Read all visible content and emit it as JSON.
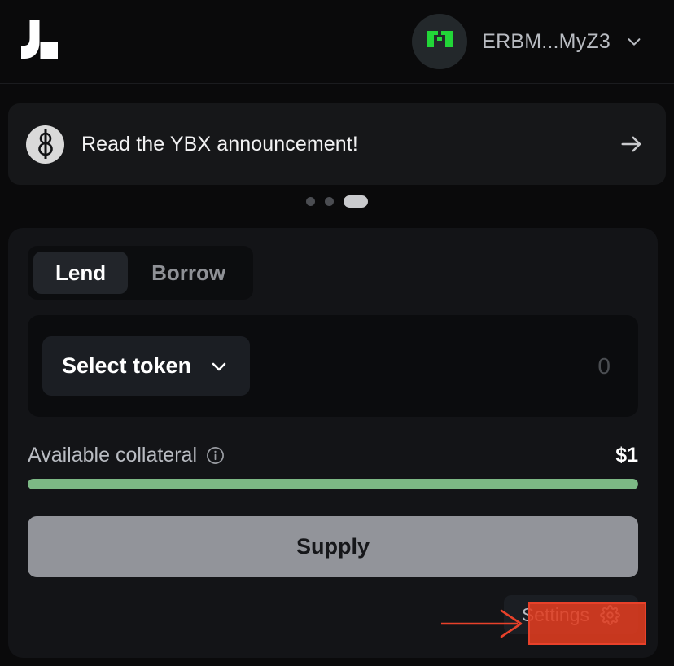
{
  "header": {
    "logo_name": "marginfi-logo",
    "wallet": {
      "address": "ERBM...MyZ3",
      "avatar_icon": "identicon-avatar",
      "chevron_icon": "chevron-down-icon"
    }
  },
  "banner": {
    "icon": "ybx-token-icon",
    "text": "Read the YBX announcement!",
    "arrow_icon": "arrow-right-icon"
  },
  "carousel": {
    "dots": [
      {
        "label": "slide-1",
        "active": false
      },
      {
        "label": "slide-2",
        "active": false
      },
      {
        "label": "slide-3",
        "active": true
      }
    ]
  },
  "action_box": {
    "tabs": [
      {
        "label": "Lend",
        "active": true
      },
      {
        "label": "Borrow",
        "active": false
      }
    ],
    "token": {
      "select_label": "Select token",
      "chevron_icon": "chevron-down-icon",
      "amount_value": "",
      "amount_placeholder": "0"
    },
    "collateral": {
      "label": "Available collateral",
      "info_icon": "info-circle-icon",
      "value": "$1",
      "progress_percent": 100,
      "bar_color": "#7cb885"
    },
    "submit": {
      "label": "Supply",
      "disabled": true
    },
    "settings": {
      "label": "Settings",
      "icon": "gear-icon"
    }
  },
  "annotation": {
    "highlight_color": "#e03c20",
    "arrow_color": "#e8412a",
    "target": "settings-button"
  }
}
